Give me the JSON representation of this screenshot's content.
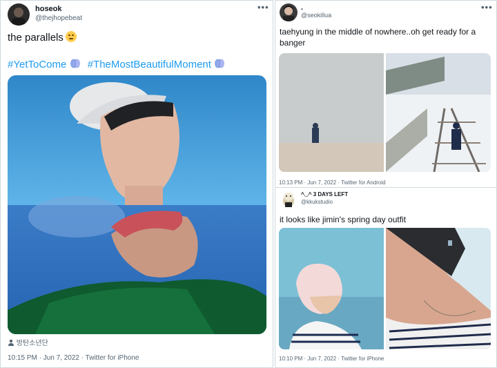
{
  "tweet1": {
    "display_name": "hoseok",
    "handle": "@thejhopebeat",
    "text": "the parallels",
    "emoji": "face-with-rolling-eyes",
    "hashtags": [
      "#YetToCome",
      "#TheMostBeautifulMoment"
    ],
    "media_tag": "방탄소년단",
    "meta": "10:15 PM · Jun 7, 2022 · Twitter for iPhone"
  },
  "tweet2": {
    "display_name": ".",
    "handle": "@seokillua",
    "text": "taehyung in the middle of nowhere..oh get ready for a banger",
    "meta": "10:13 PM · Jun 7, 2022 · Twitter for Android"
  },
  "tweet3": {
    "display_name": "^◡^ 3 DAYS LEFT",
    "handle": "@kkukstudio",
    "text": "it looks like jimin's spring day outfit",
    "meta": "10:10 PM · Jun 7, 2022 · Twitter for iPhone"
  },
  "icons": {
    "more": "more-horizontal-icon",
    "hashtag_emoji": "purple-heart-brain-icon",
    "tag": "person-tag-icon"
  },
  "colors": {
    "link": "#1d9bf0",
    "secondary": "#536471",
    "border": "#cfd9de"
  }
}
